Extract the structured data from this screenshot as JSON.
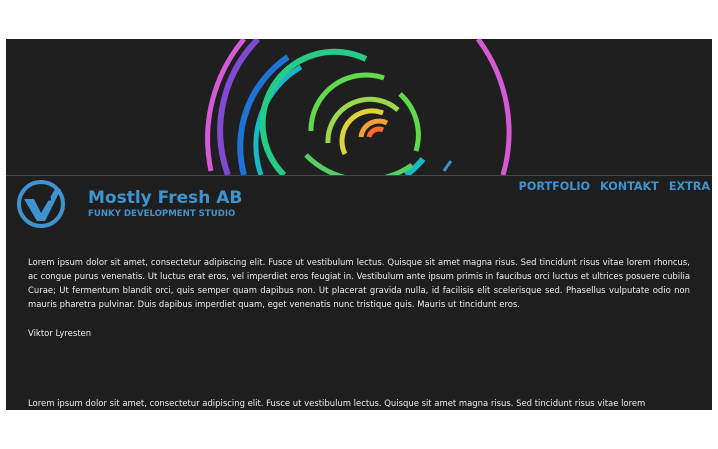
{
  "brand": {
    "name": "Mostly Fresh AB",
    "tagline": "FUNKY DEVELOPMENT STUDIO",
    "colors": {
      "accent": "#3f93cf",
      "background": "#1e1e1e",
      "text": "#f0f0f0"
    }
  },
  "navigation": [
    {
      "label": "PORTFOLIO"
    },
    {
      "label": "KONTAKT"
    },
    {
      "label": "EXTRA"
    }
  ],
  "content": {
    "paragraph_1": "Lorem ipsum dolor sit amet, consectetur adipiscing elit. Fusce ut vestibulum lectus. Quisque sit amet magna risus. Sed tincidunt risus vitae lorem rhoncus, ac congue purus venenatis. Ut luctus erat eros, vel imperdiet eros feugiat in. Vestibulum ante ipsum primis in faucibus orci luctus et ultrices posuere cubilia Curae; Ut fermentum blandit orci, quis semper quam dapibus non. Ut placerat gravida nulla, id facilisis elit scelerisque sed. Phasellus vulputate odio non mauris pharetra pulvinar. Duis dapibus imperdiet quam, eget venenatis nunc tristique quis. Mauris ut tincidunt eros.",
    "signature": "Viktor Lyresten",
    "paragraph_2": "Lorem ipsum dolor sit amet, consectetur adipiscing elit. Fusce ut vestibulum lectus. Quisque sit amet magna risus. Sed tincidunt risus vitae lorem"
  },
  "hero": {
    "graphic": "colorful-concentric-arcs",
    "colors": [
      "#d45ad6",
      "#7f49d1",
      "#1f73d6",
      "#1ab8c7",
      "#24cc87",
      "#62d94d",
      "#9ad64f",
      "#ded23d",
      "#f2a13a",
      "#ff6b2e"
    ]
  },
  "icons": {
    "logo": "mostly-fresh-logo"
  }
}
